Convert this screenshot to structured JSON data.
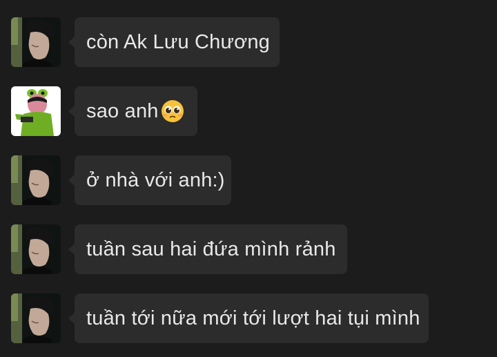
{
  "messages": [
    {
      "avatar": "user-photo-avatar",
      "text": "còn Ak Lưu Chương",
      "emoji": ""
    },
    {
      "avatar": "frog-costume-avatar",
      "text": "sao anh",
      "emoji": "pleading-face-emoji"
    },
    {
      "avatar": "user-photo-avatar",
      "text": "ở nhà với anh:)",
      "emoji": ""
    },
    {
      "avatar": "user-photo-avatar",
      "text": "tuần sau hai đứa mình rảnh",
      "emoji": ""
    },
    {
      "avatar": "user-photo-avatar",
      "text": "tuần tới nữa mới tới lượt hai tụi mình",
      "emoji": ""
    }
  ],
  "colors": {
    "background": "#1c1c1c",
    "bubble": "#2c2c2c",
    "text": "#e9e9e9"
  }
}
